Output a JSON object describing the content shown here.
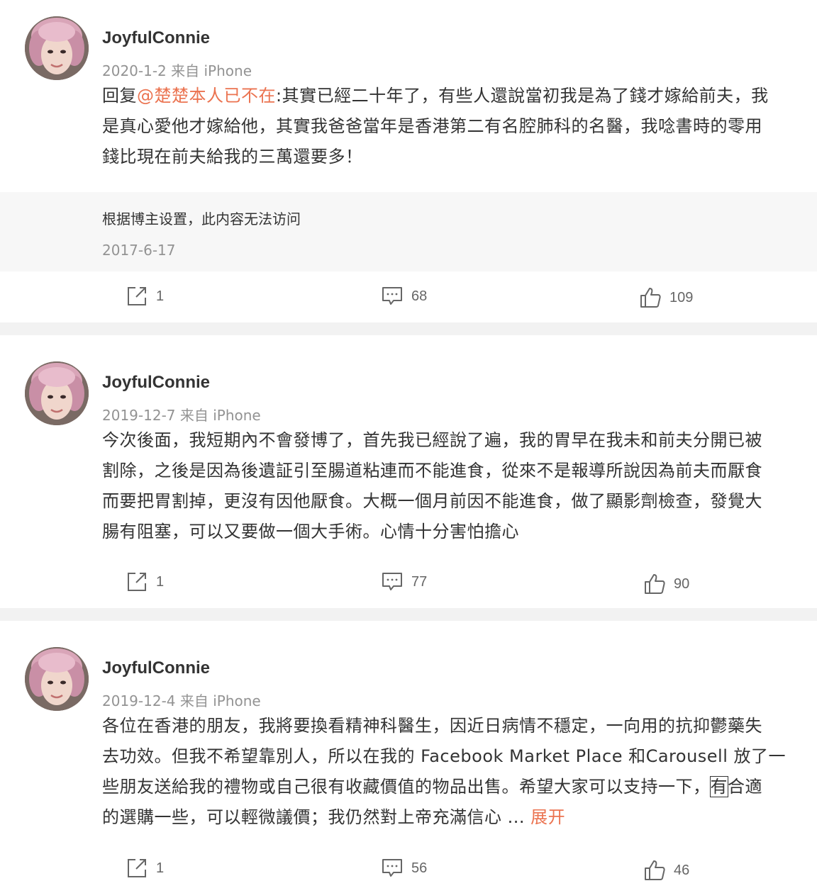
{
  "posts": [
    {
      "username": "JoyfulConnie",
      "meta": "2020-1-2  来自 iPhone",
      "reply_prefix": "回复",
      "mention": "@楚楚本人已不在",
      "text_line1": ":其實已經二十年了，有些人還說當初我是為了錢才嫁給前夫，我",
      "text_line2": "是真心愛他才嫁給他，其實我爸爸當年是香港第二有名腔肺科的名醫，我唸書時的零用",
      "text_line3": "錢比現在前夫給我的三萬還要多！",
      "quoted_text": "根据博主设置，此内容无法访问",
      "quoted_date": "2017-6-17",
      "reposts": "1",
      "comments": "68",
      "likes": "109"
    },
    {
      "username": "JoyfulConnie",
      "meta": "2019-12-7  来自 iPhone",
      "text_line1": "今次後面，我短期內不會發博了，首先我已經說了遍，我的胃早在我未和前夫分開已被",
      "text_line2": "割除，之後是因為後遺証引至腸道粘連而不能進食，從來不是報導所說因為前夫而厭食",
      "text_line3": "而要把胃割掉，更沒有因他厭食。大概一個月前因不能進食，做了顯影劑檢查，發覺大",
      "text_line4": "腸有阻塞，可以又要做一個大手術。心情十分害怕擔心",
      "reposts": "1",
      "comments": "77",
      "likes": "90"
    },
    {
      "username": "JoyfulConnie",
      "meta": "2019-12-4  来自 iPhone",
      "text_line1": "各位在香港的朋友，我將要換看精神科醫生，因近日病情不穩定，一向用的抗抑鬱藥失",
      "text_line2": "去功效。但我不希望靠別人，所以在我的 Facebook Market Place 和Carousell 放了一",
      "text_line3_a": "些朋友送給我的禮物或自己很有收藏價值的物品出售。希望大家可以支持一下，",
      "text_line3_boxed": "有",
      "text_line3_b": "合適",
      "text_line4": "的選購一些，可以輕微議價；我仍然對上帝充滿信心 ",
      "ellipsis": "...",
      "expand": "展开",
      "reposts": "1",
      "comments": "56",
      "likes": "46"
    }
  ],
  "colors": {
    "accent": "#eb7350",
    "meta": "#939393",
    "text": "#333333"
  }
}
